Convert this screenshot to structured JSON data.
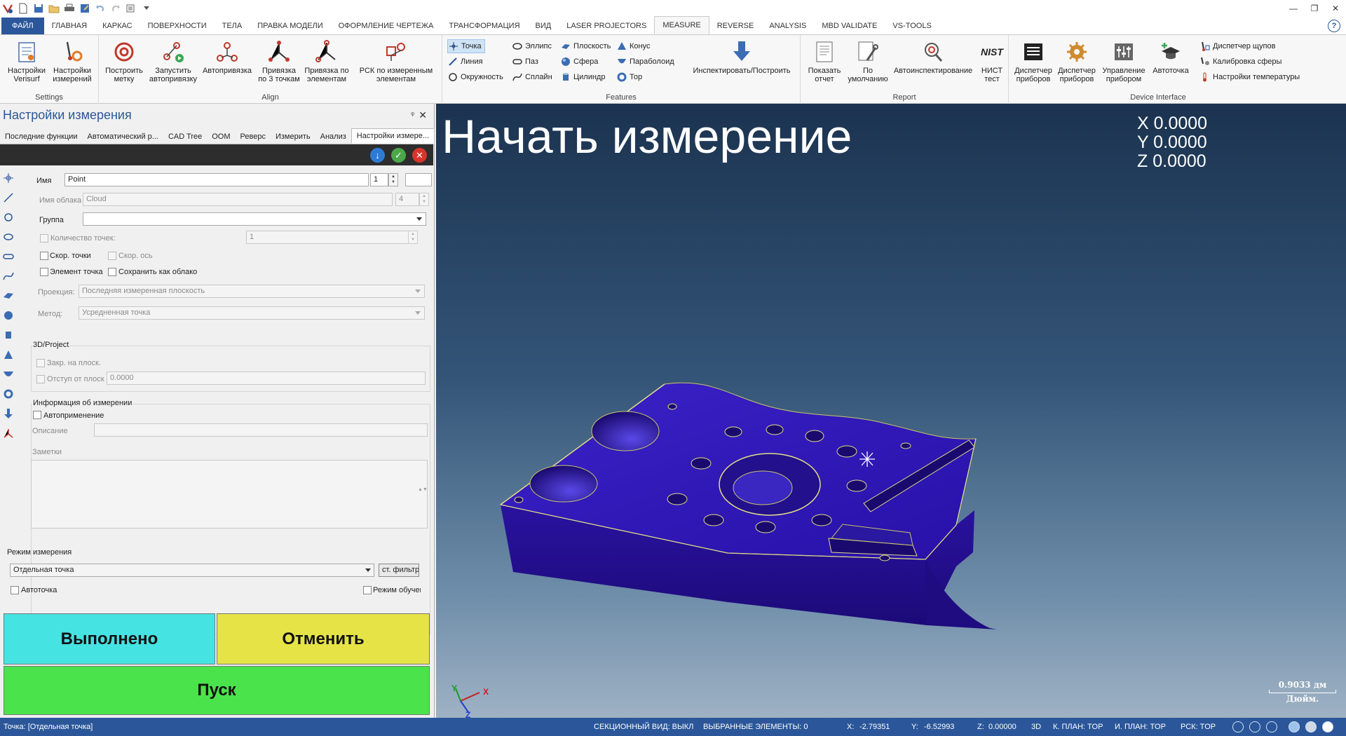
{
  "titlebar": {
    "quick_access": [
      "app-logo-icon",
      "new-icon",
      "save-icon",
      "open-icon",
      "print-icon",
      "save-as-icon",
      "undo-icon",
      "redo-icon",
      "customize-icon"
    ],
    "window_controls": [
      "—",
      "❐",
      "✕"
    ]
  },
  "ribbon_tabs": [
    "ФАЙЛ",
    "ГЛАВНАЯ",
    "КАРКАС",
    "ПОВЕРХНОСТИ",
    "ТЕЛА",
    "ПРАВКА МОДЕЛИ",
    "ОФОРМЛЕНИЕ ЧЕРТЕЖА",
    "ТРАНСФОРМАЦИЯ",
    "ВИД",
    "LASER PROJECTORS",
    "MEASURE",
    "REVERSE",
    "ANALYSIS",
    "MBD VALIDATE",
    "VS-TOOLS"
  ],
  "active_tab": "MEASURE",
  "help": "?",
  "ribbon": {
    "settings": {
      "label": "Settings",
      "b1": [
        "Настройки",
        "Verisurf"
      ],
      "b2": [
        "Настройки",
        "измерений"
      ]
    },
    "align": {
      "label": "Align",
      "b1": [
        "Построить",
        "метку"
      ],
      "b2": [
        "Запустить",
        "автопривязку"
      ],
      "b3": [
        "Автопривязка",
        ""
      ],
      "b4": [
        "Привязка",
        "по 3 точкам"
      ],
      "b5": [
        "Привязка по",
        "элементам"
      ],
      "b6": [
        "РСК по измеренным",
        "элементам"
      ]
    },
    "features": {
      "label": "Features",
      "items": [
        "Точка",
        "Линия",
        "Окружность",
        "Эллипс",
        "Паз",
        "Сплайн",
        "Плоскость",
        "Сфера",
        "Цилиндр",
        "Конус",
        "Параболоид",
        "Тор"
      ],
      "inspect": "Инспектировать/Построить"
    },
    "report": {
      "label": "Report",
      "b1": [
        "Показать",
        "отчет"
      ],
      "b2": [
        "По",
        "умолчанию"
      ],
      "b3": [
        "Автоинспектирование",
        ""
      ],
      "b4": [
        "НИСТ",
        "тест"
      ],
      "nist_logo": "NIST"
    },
    "device": {
      "label": "Device Interface",
      "b1": [
        "Диспетчер",
        "приборов"
      ],
      "b2": [
        "Диспетчер",
        "приборов"
      ],
      "b3": [
        "Управление",
        "прибором"
      ],
      "b4": [
        "Автоточка",
        ""
      ],
      "s1": "Диспетчер щупов",
      "s2": "Калибровка сферы",
      "s3": "Настройки температуры"
    }
  },
  "panel": {
    "title": "Настройки измерения",
    "pin": "ᵠ",
    "close": "✕",
    "subtabs": [
      "Последние функции",
      "Автоматический р...",
      "CAD Tree",
      "OOM",
      "Реверс",
      "Измерить",
      "Анализ",
      "Настройки измере..."
    ],
    "form": {
      "name_label": "Имя",
      "name_value": "Point",
      "name_num": "1",
      "cloud_label": "Имя облака",
      "cloud_value": "Cloud",
      "cloud_num": "4",
      "group_label": "Группа",
      "group_value": "",
      "points_count_label": "Количество точек:",
      "points_count_value": "1",
      "fast_points": "Скор. точки",
      "fast_axis": "Скор. ось",
      "element_point": "Элемент точка",
      "save_as_cloud": "Сохранить как облако",
      "projection_label": "Проекция:",
      "projection_value": "Последняя измеренная плоскость",
      "method_label": "Метод:",
      "method_value": "Усредненная точка",
      "project_group": "3D/Project",
      "lock_plane": "Закр. на плоск.",
      "offset_plane": "Отступ от плоск",
      "offset_value": "0.0000",
      "info_group": "Информация об измерении",
      "auto_apply": "Автоприменение",
      "description_label": "Описание",
      "notes_label": "Заметки",
      "mode_group": "Режим измерения",
      "mode_value": "Отдельная точка",
      "filter_button": "ст. фильтр",
      "autopoint": "Автоточка",
      "training_mode": "Режим обучен"
    },
    "done": "Выполнено",
    "cancel": "Отменить",
    "start": "Пуск"
  },
  "viewport": {
    "title": "Начать измерение",
    "x": "X 0.0000",
    "y": "Y 0.0000",
    "z": "Z 0.0000",
    "axis_x": "X",
    "axis_y": "Y",
    "axis_z": "Z",
    "scale_value": "0.9033 дм",
    "scale_unit": "Дюйм."
  },
  "status": {
    "left": "Точка: [Отдельная точка]",
    "section": "СЕКЦИОННЫЙ ВИД: ВЫКЛ",
    "selected": "ВЫБРАННЫЕ ЭЛЕМЕНТЫ: 0",
    "x_label": "X:",
    "x": "-2.79351",
    "y_label": "Y:",
    "y": "-6.52993",
    "z_label": "Z:",
    "z": "0.00000",
    "mode": "3D",
    "cplane": "К. ПЛАН: TOP",
    "iplane": "И. ПЛАН: TOP",
    "wcs": "РСК: TOP"
  },
  "colors": {
    "accent": "#2b579a",
    "done": "#46e3e3",
    "cancel": "#e6e347",
    "start": "#4be34b",
    "part": "#2a13a8"
  }
}
